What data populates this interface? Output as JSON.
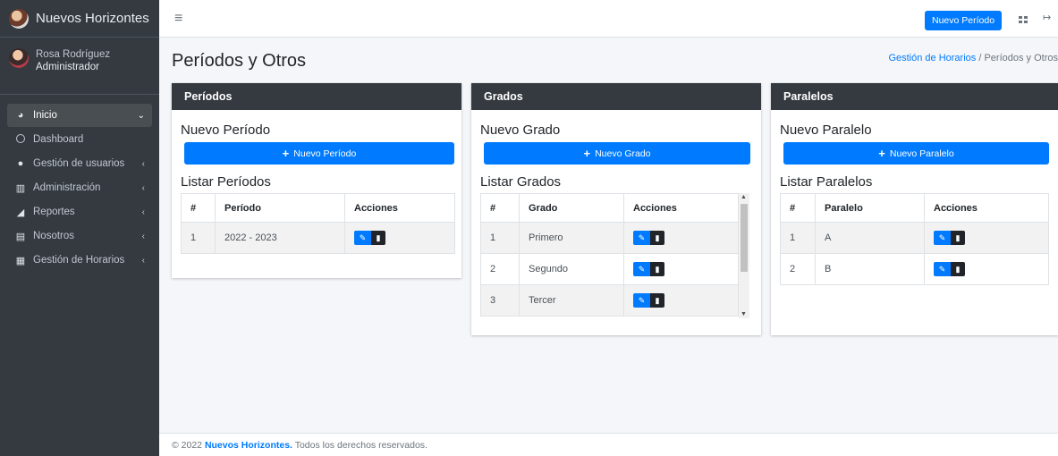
{
  "brand": {
    "name": "Nuevos Horizontes"
  },
  "user": {
    "name": "Rosa Rodríguez",
    "role": "Administrador"
  },
  "sidebar": {
    "items": [
      {
        "label": "Inicio",
        "icon": "tachometer-icon",
        "active": true,
        "caret": "⌄"
      },
      {
        "label": "Dashboard",
        "icon": "circle-icon"
      },
      {
        "label": "Gestión de usuarios",
        "icon": "user-icon",
        "caret": "‹"
      },
      {
        "label": "Administración",
        "icon": "university-icon",
        "caret": "‹"
      },
      {
        "label": "Reportes",
        "icon": "chart-area-icon",
        "caret": "‹"
      },
      {
        "label": "Nosotros",
        "icon": "id-card-icon",
        "caret": "‹"
      },
      {
        "label": "Gestión de Horarios",
        "icon": "calendar-icon",
        "caret": "‹"
      }
    ]
  },
  "topbar": {
    "menu_icon": "≡",
    "button_label": "Nuevo Período"
  },
  "header": {
    "title": "Períodos y Otros",
    "breadcrumb_link": "Gestión de Horarios",
    "breadcrumb_sep": "/",
    "breadcrumb_current": "Períodos y Otros"
  },
  "cards": {
    "periodos": {
      "header": "Períodos",
      "new_title": "Nuevo Período",
      "button_label": "Nuevo Período",
      "list_title": "Listar Períodos",
      "columns": [
        "#",
        "Período",
        "Acciones"
      ],
      "rows": [
        {
          "n": "1",
          "value": "2022 - 2023"
        }
      ]
    },
    "grados": {
      "header": "Grados",
      "new_title": "Nuevo Grado",
      "button_label": "Nuevo Grado",
      "list_title": "Listar Grados",
      "columns": [
        "#",
        "Grado",
        "Acciones"
      ],
      "rows": [
        {
          "n": "1",
          "value": "Primero"
        },
        {
          "n": "2",
          "value": "Segundo"
        },
        {
          "n": "3",
          "value": "Tercer"
        }
      ]
    },
    "paralelos": {
      "header": "Paralelos",
      "new_title": "Nuevo Paralelo",
      "button_label": "Nuevo Paralelo",
      "list_title": "Listar Paralelos",
      "columns": [
        "#",
        "Paralelo",
        "Acciones"
      ],
      "rows": [
        {
          "n": "1",
          "value": "A"
        },
        {
          "n": "2",
          "value": "B"
        }
      ]
    }
  },
  "footer": {
    "prefix": "© 2022",
    "brand": "Nuevos Horizontes.",
    "suffix": "Todos los derechos reservados."
  },
  "colors": {
    "primary": "#007bff",
    "sidebar": "#343a40",
    "card_header": "#343a40"
  }
}
